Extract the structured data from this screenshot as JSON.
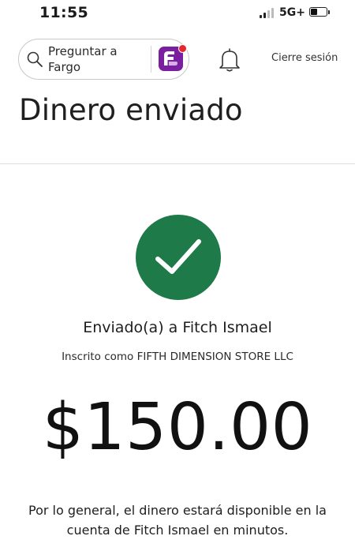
{
  "status_bar": {
    "time": "11:55",
    "network": "5G+",
    "battery_level": 0.45
  },
  "header": {
    "search_placeholder": "Preguntar a Fargo",
    "sign_out_label": "Cierre sesión"
  },
  "page": {
    "title": "Dinero enviado"
  },
  "confirmation": {
    "sent_to": "Enviado(a) a Fitch Ismael",
    "enrolled_as": "Inscrito como FIFTH DIMENSION STORE LLC",
    "amount": "$150.00",
    "note": "Por lo general, el dinero estará disponible en la cuenta de Fitch Ismael en minutos."
  },
  "colors": {
    "success_green": "#1f7a4a",
    "fargo_purple": "#7a1fa0",
    "notification_red": "#e52630"
  },
  "icons": [
    "search-icon",
    "fargo-logo-icon",
    "bell-icon",
    "checkmark-icon",
    "signal-icon",
    "battery-icon"
  ]
}
